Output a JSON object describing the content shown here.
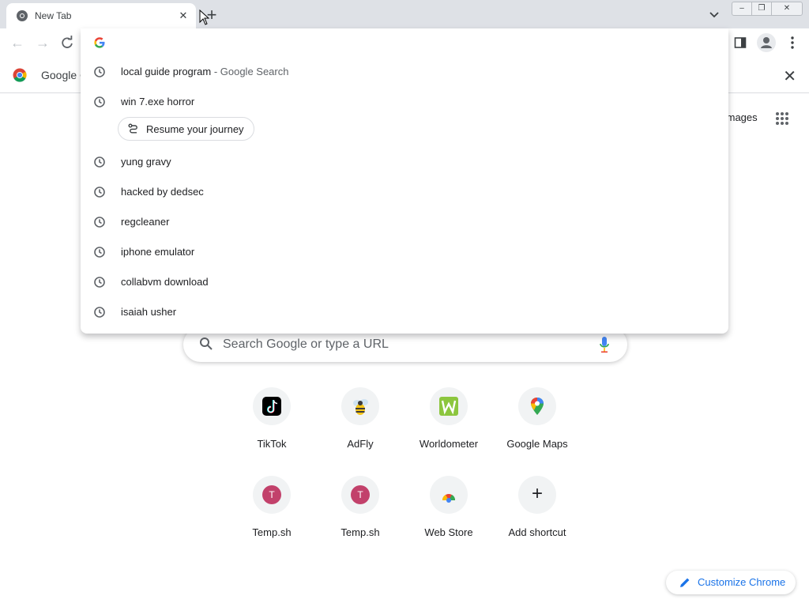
{
  "tab": {
    "title": "New Tab",
    "close": "✕"
  },
  "new_tab_symbol": "+",
  "window_controls": {
    "minimize": "–",
    "restore": "❐",
    "close": "✕"
  },
  "infobar": {
    "text": "Google C",
    "close": "✕"
  },
  "header": {
    "images_link": "Images"
  },
  "search": {
    "placeholder": "Search Google or type a URL"
  },
  "omnibox": {
    "suggestions": [
      {
        "text": "local guide program",
        "sub": "- Google Search"
      },
      {
        "text": "win 7.exe horror",
        "sub": ""
      },
      {
        "text": "yung gravy",
        "sub": ""
      },
      {
        "text": "hacked by dedsec",
        "sub": ""
      },
      {
        "text": "regcleaner",
        "sub": ""
      },
      {
        "text": "iphone emulator",
        "sub": ""
      },
      {
        "text": "collabvm download",
        "sub": ""
      },
      {
        "text": "isaiah usher",
        "sub": ""
      }
    ],
    "journey_chip": "Resume your journey"
  },
  "shortcuts": [
    {
      "label": "TikTok",
      "icon": "tiktok-icon"
    },
    {
      "label": "AdFly",
      "icon": "adfly-icon"
    },
    {
      "label": "Worldometer",
      "icon": "worldometer-icon"
    },
    {
      "label": "Google Maps",
      "icon": "google-maps-icon"
    },
    {
      "label": "Temp.sh",
      "icon": "letter-t-icon",
      "letter": "T"
    },
    {
      "label": "Temp.sh",
      "icon": "letter-t-icon",
      "letter": "T"
    },
    {
      "label": "Web Store",
      "icon": "chrome-web-store-icon"
    },
    {
      "label": "Add shortcut",
      "icon": "plus-icon",
      "symbol": "+"
    }
  ],
  "customize": {
    "label": "Customize Chrome"
  },
  "colors": {
    "accent": "#1a73e8",
    "tab_strip": "#dee1e6",
    "tile_letter_bg": "#c2416b"
  }
}
